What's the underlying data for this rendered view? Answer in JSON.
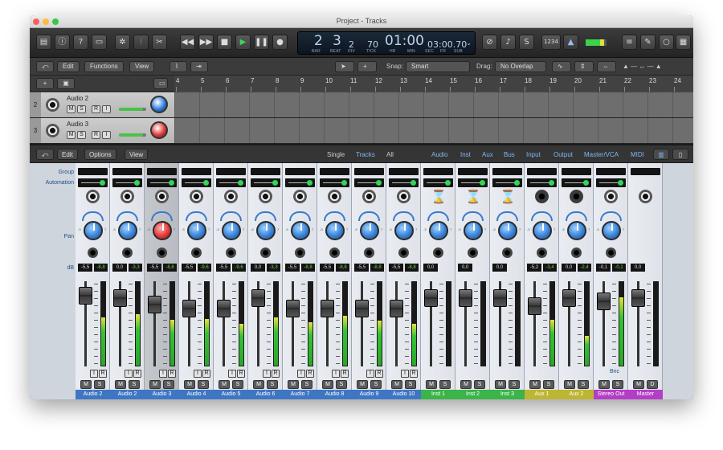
{
  "window": {
    "title": "Project - Tracks"
  },
  "control_bar": {
    "lcd": {
      "bar": "2",
      "beat": "3",
      "div": "2",
      "tick": "70",
      "time": "01:00",
      "time_fine": "03:00.70",
      "labels": {
        "bar": "BAR",
        "beat": "BEAT",
        "div": "DIV",
        "tick": "TICK",
        "hr": "HR",
        "min": "MIN",
        "sec": "SEC",
        "fr": "FR",
        "sub": "SUB"
      }
    },
    "key_label": "1234"
  },
  "edit_bar": {
    "edit": "Edit",
    "functions": "Functions",
    "view": "View",
    "snap_label": "Snap:",
    "snap_value": "Smart",
    "drag_label": "Drag:",
    "drag_value": "No Overlap"
  },
  "ruler": [
    "4",
    "5",
    "6",
    "7",
    "8",
    "9",
    "10",
    "11",
    "12",
    "13",
    "14",
    "15",
    "16",
    "17",
    "18",
    "19",
    "20",
    "21",
    "22",
    "23",
    "24"
  ],
  "tracks": [
    {
      "num": "2",
      "name": "Audio 2",
      "knob_color": "#2f7de0"
    },
    {
      "num": "3",
      "name": "Audio 3",
      "knob_color": "#e23a3a"
    }
  ],
  "mixer_header": {
    "edit": "Edit",
    "options": "Options",
    "view": "View",
    "modes": [
      "Single",
      "Tracks",
      "All"
    ],
    "filters": [
      "Audio",
      "Inst",
      "Aux",
      "Bus",
      "Input",
      "Output",
      "Master/VCA",
      "MIDI"
    ]
  },
  "row_labels": {
    "group": "Group",
    "automation": "Automation",
    "pan": "Pan",
    "db": "dB"
  },
  "strips": [
    {
      "name": "Audio 2",
      "db_left": "-5,5",
      "db_right": "-8,8",
      "color": "#3f76c3",
      "meter": 0.58
    },
    {
      "name": "Audio 2",
      "db_left": "0,0",
      "db_right": "-3,3",
      "color": "#3f76c3",
      "meter": 0.62
    },
    {
      "name": "Audio 3",
      "db_left": "-5,5",
      "db_right": "-8,8",
      "color": "#3f76c3",
      "meter": 0.55
    },
    {
      "name": "Audio 4",
      "db_left": "-5,5",
      "db_right": "-9,6",
      "color": "#3f76c3",
      "meter": 0.56
    },
    {
      "name": "Audio 5",
      "db_left": "-5,5",
      "db_right": "-9,6",
      "color": "#3f76c3",
      "meter": 0.5
    },
    {
      "name": "Audio 6",
      "db_left": "0,0",
      "db_right": "-3,3",
      "color": "#3f76c3",
      "meter": 0.58
    },
    {
      "name": "Audio 7",
      "db_left": "-5,5",
      "db_right": "-8,8",
      "color": "#3f76c3",
      "meter": 0.52
    },
    {
      "name": "Audio 8",
      "db_left": "-5,5",
      "db_right": "-8,8",
      "color": "#3f76c3",
      "meter": 0.6
    },
    {
      "name": "Audio 9",
      "db_left": "-5,5",
      "db_right": "-8,8",
      "color": "#3f76c3",
      "meter": 0.54
    },
    {
      "name": "Audio 10",
      "db_left": "-5,5",
      "db_right": "-8,8",
      "color": "#3f76c3",
      "meter": 0.5
    },
    {
      "name": "Inst 1",
      "db_left": "0,0",
      "db_right": "",
      "color": "#3bb44a",
      "meter": 0
    },
    {
      "name": "Inst 2",
      "db_left": "0,0",
      "db_right": "",
      "color": "#3bb44a",
      "meter": 0
    },
    {
      "name": "Inst 3",
      "db_left": "0,0",
      "db_right": "",
      "color": "#3bb44a",
      "meter": 0
    },
    {
      "name": "Aux 1",
      "db_left": "-5,2",
      "db_right": "-3,4",
      "color": "#bdb632",
      "meter": 0.55
    },
    {
      "name": "Aux 2",
      "db_left": "0,0",
      "db_right": "-2,4",
      "color": "#bdb632",
      "meter": 0.36
    },
    {
      "name": "Stereo Out",
      "db_left": "-0,1",
      "db_right": "-0,1",
      "color": "#b43dc6",
      "meter": 0.82
    },
    {
      "name": "Master",
      "db_left": "0,0",
      "db_right": "",
      "color": "#b43dc6",
      "meter": 0
    }
  ],
  "bnc_label": "Bnc",
  "buttons": {
    "m": "M",
    "s": "S",
    "r": "R",
    "i": "I",
    "d": "D"
  }
}
